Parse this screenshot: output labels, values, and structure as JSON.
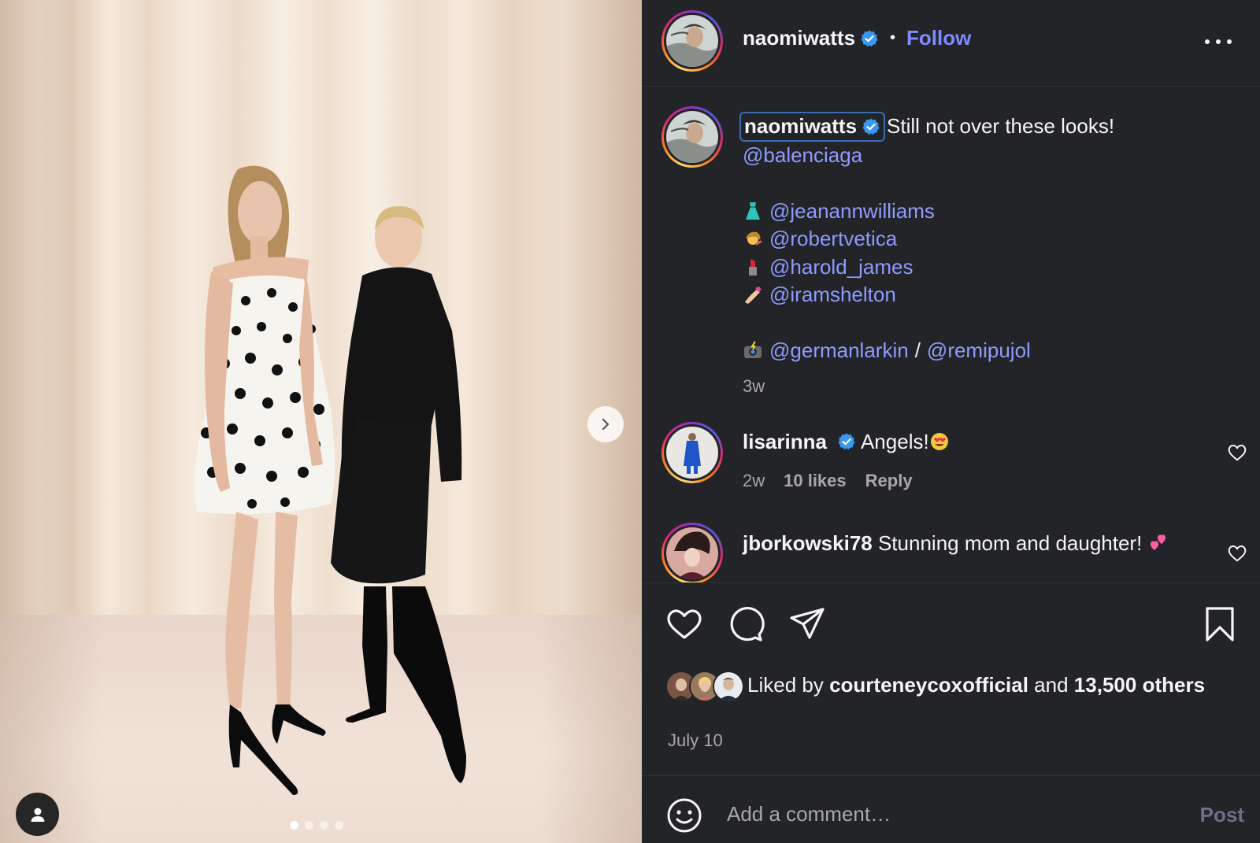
{
  "post": {
    "author": "naomiwatts",
    "follow_label": "Follow",
    "separator": "•",
    "caption": {
      "username": "naomiwatts",
      "text": "Still not over these looks!",
      "mention_main": "@balenciaga",
      "credits": [
        {
          "emoji": "dress-emoji",
          "handle": "@jeanannwilliams"
        },
        {
          "emoji": "haircut-emoji",
          "handle": "@robertvetica"
        },
        {
          "emoji": "lipstick-emoji",
          "handle": "@harold_james"
        },
        {
          "emoji": "nail-polish-emoji",
          "handle": "@iramshelton"
        }
      ],
      "photo_credit": {
        "emoji": "camera-flash-emoji",
        "handle_1": "@germanlarkin",
        "slash": "/",
        "handle_2": "@remipujol"
      },
      "age": "3w"
    },
    "comments": [
      {
        "username": "lisarinna",
        "verified": true,
        "text": "Angels!",
        "emoji": "heart-eyes-emoji",
        "age": "2w",
        "likes": "10 likes",
        "reply_label": "Reply"
      },
      {
        "username": "jborkowski78",
        "verified": false,
        "text": "Stunning mom and daughter!",
        "emoji": "two-hearts-emoji"
      }
    ],
    "liked_by": {
      "prefix": "Liked by",
      "user": "courteneycoxofficial",
      "joiner": "and",
      "count": "13,500",
      "suffix": "others"
    },
    "date": "July 10",
    "add_comment": {
      "placeholder": "Add a comment…",
      "post_label": "Post"
    },
    "carousel": {
      "count": 4,
      "active": 0
    }
  },
  "colors": {
    "panel_bg": "#232428",
    "link": "#8e9bff",
    "verified": "#3897f0",
    "muted": "#a8a8a8"
  }
}
